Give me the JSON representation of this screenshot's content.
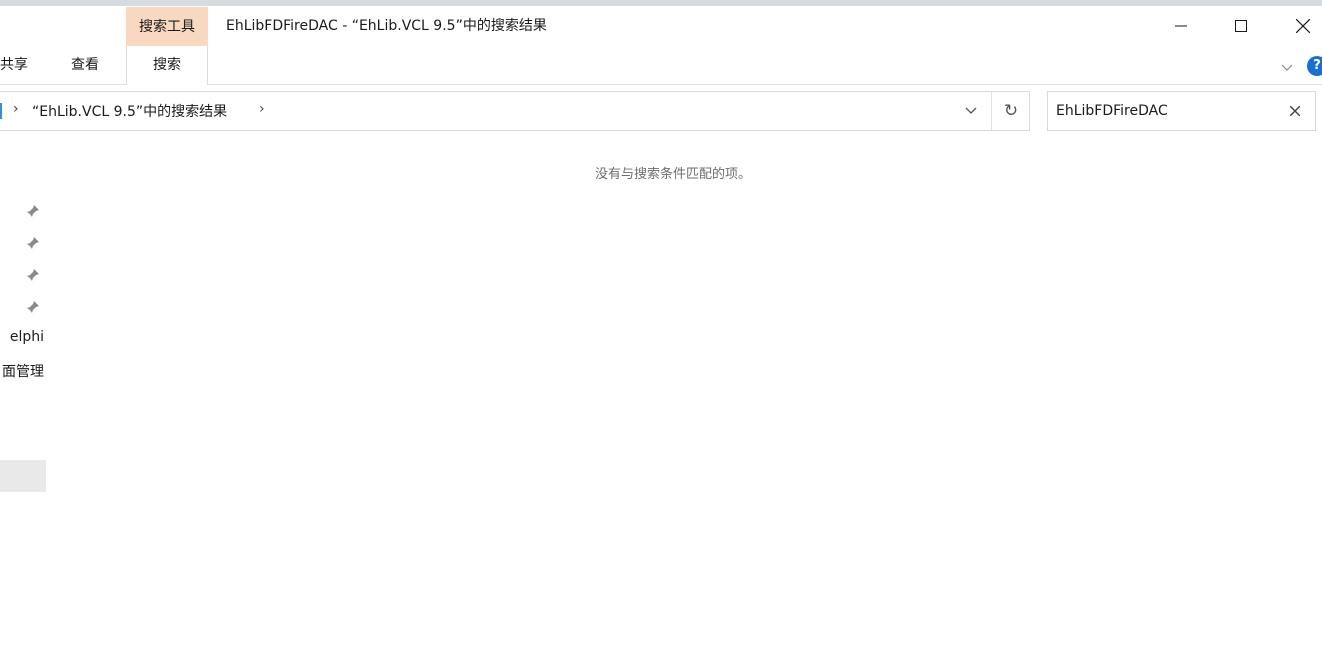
{
  "titlebar": {
    "context_tab": "搜索工具",
    "title": "EhLib​FD​Fire​DAC - “EhLib.VCL 9.5”中的搜索结果",
    "minimize_icon": "minimize-icon",
    "maximize_icon": "maximize-icon",
    "close_icon": "close-icon"
  },
  "ribbon": {
    "tabs": [
      {
        "label": "共享"
      },
      {
        "label": "查看"
      },
      {
        "label": "搜索"
      }
    ],
    "help_label": "?"
  },
  "address_bar": {
    "sep1": "›",
    "breadcrumb": "“EhLib.VCL 9.5”中的搜索结果",
    "sep2": "›",
    "refresh": "↻"
  },
  "search": {
    "value": "EhLibFDFireDAC"
  },
  "nav": {
    "items": [
      {
        "label": "elphi"
      },
      {
        "label": "面管理"
      }
    ]
  },
  "content": {
    "empty_message": "没有与搜索条件匹配的项。"
  }
}
